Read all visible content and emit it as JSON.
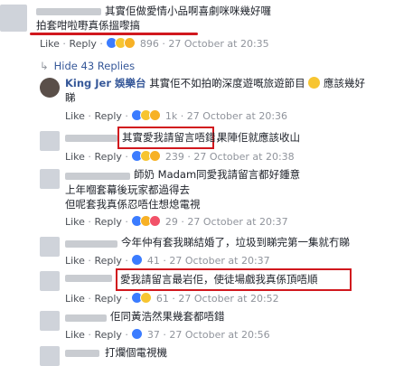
{
  "comments": [
    {
      "text_line1": "其實佢做愛情小品啊喜劇咪咪幾好囉",
      "text_line2": "拍套咁啦嘢真係搵嚟搞",
      "actions": {
        "like": "Like",
        "reply": "Reply"
      },
      "reaction_count": "896",
      "timestamp": "27 October at 20:35"
    },
    {
      "hide_replies": "Hide 43 Replies"
    },
    {
      "author": "King Jer 娛樂台",
      "text_line1": "其實佢不如拍啲深度遊嘅旅遊節目",
      "text_line1_tail": "應該幾好",
      "text_line2": "睇",
      "actions": {
        "like": "Like",
        "reply": "Reply"
      },
      "reaction_count": "1k",
      "timestamp": "27 October at 20:36"
    },
    {
      "text_boxed": "其實愛我請留言唔錯，",
      "text_tail": "果陣佢就應該收山",
      "actions": {
        "like": "Like",
        "reply": "Reply"
      },
      "reaction_count": "239",
      "timestamp": "27 October at 20:38"
    },
    {
      "text_line1": "師奶 Madam同愛我請留言都好鍾意",
      "text_line2": "上年嗰套幕後玩家都過得去",
      "text_line3": "但呢套我真係忍唔住想熄電視",
      "actions": {
        "like": "Like",
        "reply": "Reply"
      },
      "reaction_count": "29",
      "timestamp": "27 October at 20:37"
    },
    {
      "text_line1": "今年仲有套我睇結婚了，垃圾到睇完第一集就冇睇",
      "actions": {
        "like": "Like",
        "reply": "Reply"
      },
      "reaction_count": "41",
      "timestamp": "27 October at 20:37"
    },
    {
      "text_boxed": "愛我請留言最岩佢，使徒場戲我真係頂唔順",
      "actions": {
        "like": "Like",
        "reply": "Reply"
      },
      "reaction_count": "61",
      "timestamp": "27 October at 20:52"
    },
    {
      "text_line1": "佢同黃浩然果幾套都唔錯",
      "actions": {
        "like": "Like",
        "reply": "Reply"
      },
      "reaction_count": "37",
      "timestamp": "27 October at 20:56"
    },
    {
      "text_line1": "打爛個電視機"
    }
  ],
  "colors": {
    "highlight": "#d1181e",
    "link": "#365899",
    "meta": "#90949c"
  }
}
